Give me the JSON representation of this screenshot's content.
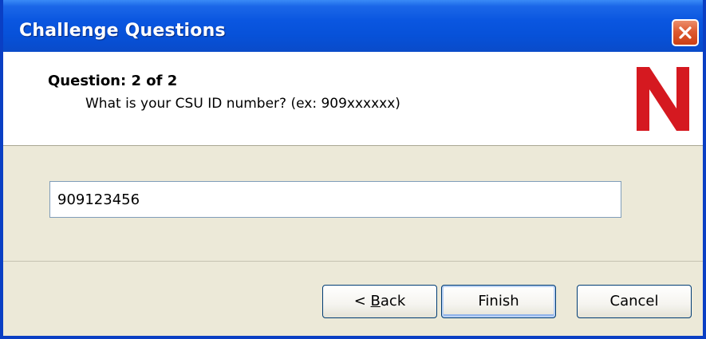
{
  "window": {
    "title": "Challenge Questions"
  },
  "header": {
    "question_label": "Question:  2 of 2",
    "question_text": "What is your CSU ID number? (ex:  909xxxxxx)",
    "logo_icon": "novell-n-logo",
    "logo_color": "#d51920"
  },
  "form": {
    "answer_value": "909123456"
  },
  "buttons": {
    "back_prefix": "< ",
    "back_access_key": "B",
    "back_rest": "ack",
    "finish_label": "Finish",
    "cancel_label": "Cancel"
  },
  "colors": {
    "titlebar": "#0a56e0",
    "close_button": "#dd5a31",
    "dialog_face": "#ece9d8"
  }
}
